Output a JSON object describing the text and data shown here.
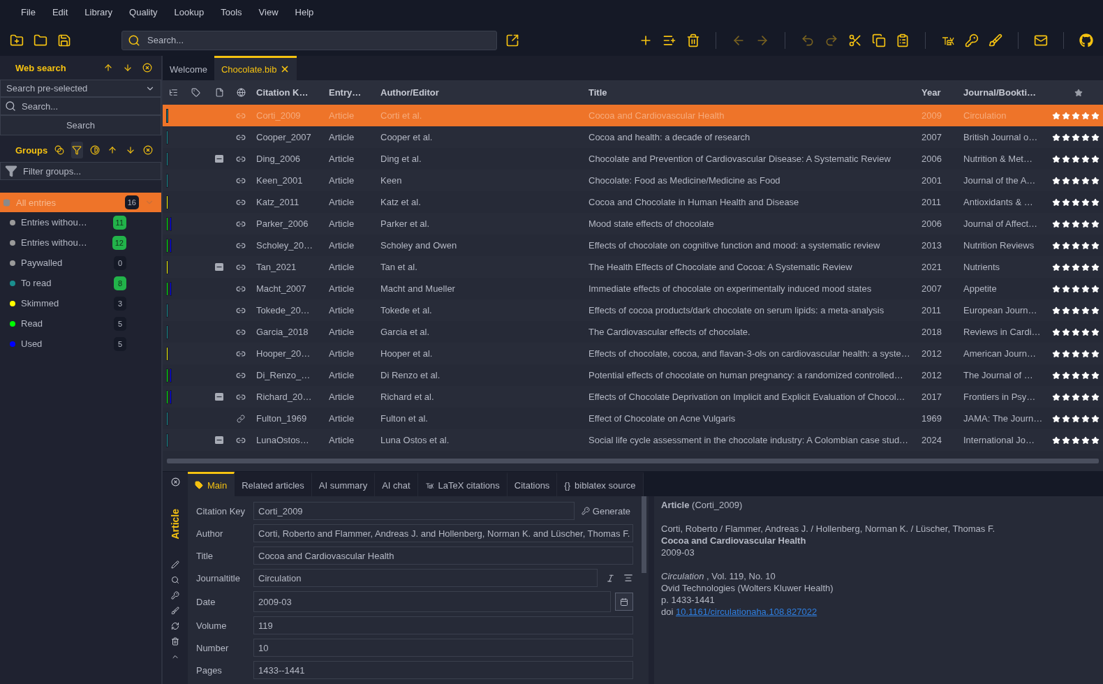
{
  "menu": [
    "File",
    "Edit",
    "Library",
    "Quality",
    "Lookup",
    "Tools",
    "View",
    "Help"
  ],
  "toolbar": {
    "left": [
      {
        "kind": "new-library",
        "disabled": false
      },
      {
        "kind": "open",
        "disabled": false
      },
      {
        "kind": "save",
        "disabled": false
      }
    ],
    "search": {
      "placeholder": "Search..."
    },
    "right": [
      {
        "kind": "add",
        "disabled": false
      },
      {
        "kind": "add-list",
        "disabled": false
      },
      {
        "kind": "delete",
        "disabled": false
      },
      {
        "kind": "separator"
      },
      {
        "kind": "back",
        "disabled": true
      },
      {
        "kind": "forward",
        "disabled": true
      },
      {
        "kind": "separator"
      },
      {
        "kind": "undo",
        "disabled": true
      },
      {
        "kind": "redo",
        "disabled": true
      },
      {
        "kind": "cut",
        "disabled": false
      },
      {
        "kind": "copy",
        "disabled": false
      },
      {
        "kind": "paste",
        "disabled": false
      },
      {
        "kind": "separator"
      },
      {
        "kind": "tex",
        "disabled": false
      },
      {
        "kind": "key",
        "disabled": false
      },
      {
        "kind": "cleanup",
        "disabled": false
      },
      {
        "kind": "separator"
      },
      {
        "kind": "mail",
        "disabled": false
      },
      {
        "kind": "separator"
      },
      {
        "kind": "github",
        "disabled": false
      }
    ]
  },
  "web_search": {
    "title": "Web search",
    "fetcher": "Search pre-selected",
    "search": {
      "placeholder": "Search..."
    },
    "button": "Search"
  },
  "groups": {
    "title": "Groups",
    "tools": [
      {
        "kind": "intersection",
        "selected": false
      },
      {
        "kind": "filter",
        "selected": true
      },
      {
        "kind": "invert",
        "selected": false
      }
    ],
    "filter": {
      "placeholder": "Filter groups..."
    },
    "items": [
      {
        "kind": "root",
        "name": "All entries",
        "count": "16",
        "selected": true,
        "highlighted": false,
        "color": "#8a8a8a"
      },
      {
        "kind": "group",
        "name": "Entries withou…",
        "count": "11",
        "selected": false,
        "highlighted": true,
        "color": "#9a9a9a"
      },
      {
        "kind": "group",
        "name": "Entries withou…",
        "count": "12",
        "selected": false,
        "highlighted": true,
        "color": "#9a9a9a"
      },
      {
        "kind": "group",
        "name": "Paywalled",
        "count": "0",
        "selected": false,
        "highlighted": false,
        "color": "#9a9a9a"
      },
      {
        "kind": "group",
        "name": "To read",
        "count": "8",
        "selected": false,
        "highlighted": true,
        "color": "#1a8f8f"
      },
      {
        "kind": "group",
        "name": "Skimmed",
        "count": "3",
        "selected": false,
        "highlighted": false,
        "color": "#ffff00"
      },
      {
        "kind": "group",
        "name": "Read",
        "count": "5",
        "selected": false,
        "highlighted": false,
        "color": "#00ff00"
      },
      {
        "kind": "group",
        "name": "Used",
        "count": "5",
        "selected": false,
        "highlighted": false,
        "color": "#0000ff"
      }
    ]
  },
  "library_tabs": [
    {
      "label": "Welcome",
      "selected": false,
      "closable": false
    },
    {
      "label": "Chocolate.bib",
      "selected": true,
      "closable": true
    }
  ],
  "table": {
    "columns": [
      "Citation K…",
      "Entry…",
      "Author/Editor",
      "Title",
      "Year",
      "Journal/Bookti…"
    ],
    "rows": [
      {
        "kind": "doi",
        "selected": true,
        "group_marks": [
          {
            "color": "#1a8f8f"
          }
        ],
        "pdf": false,
        "key": "Corti_2009",
        "type": "Article",
        "author": "Corti et al.",
        "title": "Cocoa and Cardiovascular Health",
        "year": "2009",
        "journal": "Circulation",
        "stars": 5
      },
      {
        "kind": "doi",
        "selected": false,
        "group_marks": [
          {
            "color": "#1a8f8f"
          }
        ],
        "pdf": false,
        "key": "Cooper_2007",
        "type": "Article",
        "author": "Cooper et al.",
        "title": "Cocoa and health: a decade of research",
        "year": "2007",
        "journal": "British Journal o…",
        "stars": 5
      },
      {
        "kind": "doi",
        "selected": false,
        "group_marks": [
          {
            "color": "#1a8f8f"
          }
        ],
        "pdf": true,
        "key": "Ding_2006",
        "type": "Article",
        "author": "Ding et al.",
        "title": "Chocolate and Prevention of Cardiovascular Disease: A Systematic Review",
        "year": "2006",
        "journal": "Nutrition & Met…",
        "stars": 5
      },
      {
        "kind": "doi",
        "selected": false,
        "group_marks": [
          {
            "color": "#1a8f8f"
          }
        ],
        "pdf": false,
        "key": "Keen_2001",
        "type": "Article",
        "author": "Keen",
        "title": "Chocolate: Food as Medicine/Medicine as Food",
        "year": "2001",
        "journal": "Journal of the A…",
        "stars": 5
      },
      {
        "kind": "doi",
        "selected": false,
        "group_marks": [
          {
            "color": "#ffff00"
          }
        ],
        "pdf": false,
        "key": "Katz_2011",
        "type": "Article",
        "author": "Katz et al.",
        "title": "Cocoa and Chocolate in Human Health and Disease",
        "year": "2011",
        "journal": "Antioxidants & …",
        "stars": 5
      },
      {
        "kind": "doi",
        "selected": false,
        "group_marks": [
          {
            "color": "#00ff00"
          },
          {
            "color": "#0000ff"
          }
        ],
        "pdf": false,
        "key": "Parker_2006",
        "type": "Article",
        "author": "Parker et al.",
        "title": "Mood state effects of chocolate",
        "year": "2006",
        "journal": "Journal of Affect…",
        "stars": 5
      },
      {
        "kind": "doi",
        "selected": false,
        "group_marks": [
          {
            "color": "#00ff00"
          },
          {
            "color": "#0000ff"
          }
        ],
        "pdf": false,
        "key": "Scholey_20…",
        "type": "Article",
        "author": "Scholey and Owen",
        "title": "Effects of chocolate on cognitive function and mood: a systematic review",
        "year": "2013",
        "journal": "Nutrition Reviews",
        "stars": 5
      },
      {
        "kind": "doi",
        "selected": false,
        "group_marks": [
          {
            "color": "#ffff00"
          }
        ],
        "pdf": true,
        "key": "Tan_2021",
        "type": "Article",
        "author": "Tan et al.",
        "title": "The Health Effects of Chocolate and Cocoa: A Systematic Review",
        "year": "2021",
        "journal": "Nutrients",
        "stars": 5
      },
      {
        "kind": "doi",
        "selected": false,
        "group_marks": [
          {
            "color": "#00ff00"
          },
          {
            "color": "#0000ff"
          }
        ],
        "pdf": false,
        "key": "Macht_2007",
        "type": "Article",
        "author": "Macht and Mueller",
        "title": "Immediate effects of chocolate on experimentally induced mood states",
        "year": "2007",
        "journal": "Appetite",
        "stars": 5
      },
      {
        "kind": "doi",
        "selected": false,
        "group_marks": [
          {
            "color": "#1a8f8f"
          }
        ],
        "pdf": false,
        "key": "Tokede_20…",
        "type": "Article",
        "author": "Tokede et al.",
        "title": "Effects of cocoa products/dark chocolate on serum lipids: a meta-analysis",
        "year": "2011",
        "journal": "European Journ…",
        "stars": 5
      },
      {
        "kind": "doi",
        "selected": false,
        "group_marks": [
          {
            "color": "#1a8f8f"
          }
        ],
        "pdf": false,
        "key": "Garcia_2018",
        "type": "Article",
        "author": "Garcia et al.",
        "title": "The Cardiovascular effects of chocolate.",
        "year": "2018",
        "journal": "Reviews in Cardi…",
        "stars": 5
      },
      {
        "kind": "doi",
        "selected": false,
        "group_marks": [
          {
            "color": "#ffff00"
          }
        ],
        "pdf": false,
        "key": "Hooper_20…",
        "type": "Article",
        "author": "Hooper et al.",
        "title": "Effects of chocolate, cocoa, and flavan-3-ols on cardiovascular health: a syste…",
        "year": "2012",
        "journal": "American Journ…",
        "stars": 5
      },
      {
        "kind": "doi",
        "selected": false,
        "group_marks": [
          {
            "color": "#00ff00"
          },
          {
            "color": "#0000ff"
          }
        ],
        "pdf": false,
        "key": "Di_Renzo_…",
        "type": "Article",
        "author": "Di Renzo et al.",
        "title": "Potential effects of chocolate on human pregnancy: a randomized controlled…",
        "year": "2012",
        "journal": "The Journal of …",
        "stars": 5
      },
      {
        "kind": "doi",
        "selected": false,
        "group_marks": [
          {
            "color": "#00ff00"
          },
          {
            "color": "#0000ff"
          }
        ],
        "pdf": true,
        "key": "Richard_20…",
        "type": "Article",
        "author": "Richard et al.",
        "title": "Effects of Chocolate Deprivation on Implicit and Explicit Evaluation of Chocol…",
        "year": "2017",
        "journal": "Frontiers in Psy…",
        "stars": 5
      },
      {
        "kind": "url",
        "selected": false,
        "group_marks": [
          {
            "color": "#1a8f8f"
          }
        ],
        "pdf": false,
        "key": "Fulton_1969",
        "type": "Article",
        "author": "Fulton et al.",
        "title": "Effect of Chocolate on Acne Vulgaris",
        "year": "1969",
        "journal": "JAMA: The Journ…",
        "stars": 5
      },
      {
        "kind": "doi",
        "selected": false,
        "group_marks": [
          {
            "color": "#1a8f8f"
          }
        ],
        "pdf": true,
        "key": "LunaOstos…",
        "type": "Article",
        "author": "Luna Ostos et al.",
        "title": "Social life cycle assessment in the chocolate industry: A Colombian case stud…",
        "year": "2024",
        "journal": "International Jo…",
        "stars": 5
      }
    ]
  },
  "entry_editor": {
    "entry_type": "Article",
    "tabs": [
      {
        "kind": "tagged",
        "label": "Main",
        "selected": true
      },
      {
        "kind": "plain",
        "label": "Related articles",
        "selected": false
      },
      {
        "kind": "plain",
        "label": "AI summary",
        "selected": false
      },
      {
        "kind": "plain",
        "label": "AI chat",
        "selected": false
      },
      {
        "kind": "tex",
        "label": "LaTeX citations",
        "selected": false
      },
      {
        "kind": "plain",
        "label": "Citations",
        "selected": false
      },
      {
        "kind": "source",
        "label": "biblatex source",
        "selected": false,
        "prefix": "{}"
      }
    ],
    "generate_button": "Generate",
    "fields": [
      {
        "kind": "key",
        "label": "Citation Key",
        "value": "Corti_2009"
      },
      {
        "kind": "text",
        "label": "Author",
        "value": "Corti, Roberto and Flammer, Andreas J. and Hollenberg, Norman K. and Lüscher, Thomas F."
      },
      {
        "kind": "text",
        "label": "Title",
        "value": "Cocoa and Cardiovascular Health"
      },
      {
        "kind": "journal",
        "label": "Journaltitle",
        "value": "Circulation"
      },
      {
        "kind": "date",
        "label": "Date",
        "value": "2009-03"
      },
      {
        "kind": "text",
        "label": "Volume",
        "value": "119"
      },
      {
        "kind": "text",
        "label": "Number",
        "value": "10"
      },
      {
        "kind": "text",
        "label": "Pages",
        "value": "1433--1441"
      }
    ]
  },
  "preview": {
    "lines": [
      {
        "kind": "plain",
        "text": "**Article** (Corti_2009)"
      },
      {
        "kind": "plain",
        "text": "Corti, Roberto / Flammer, Andreas J. / Hollenberg, Norman K. / Lüscher, Thomas F.",
        "space_before": true
      },
      {
        "kind": "bold",
        "text": "Cocoa and Cardiovascular Health"
      },
      {
        "kind": "plain",
        "text": "2009-03"
      },
      {
        "kind": "plain",
        "text": "*Circulation* , Vol. 119, No. 10",
        "space_before": true
      },
      {
        "kind": "plain",
        "text": "Ovid Technologies (Wolters Kluwer Health)"
      },
      {
        "kind": "plain",
        "text": "p. 1433-1441"
      },
      {
        "kind": "doi",
        "text": "doi",
        "link": "10.1161/circulationaha.108.827022"
      }
    ]
  }
}
